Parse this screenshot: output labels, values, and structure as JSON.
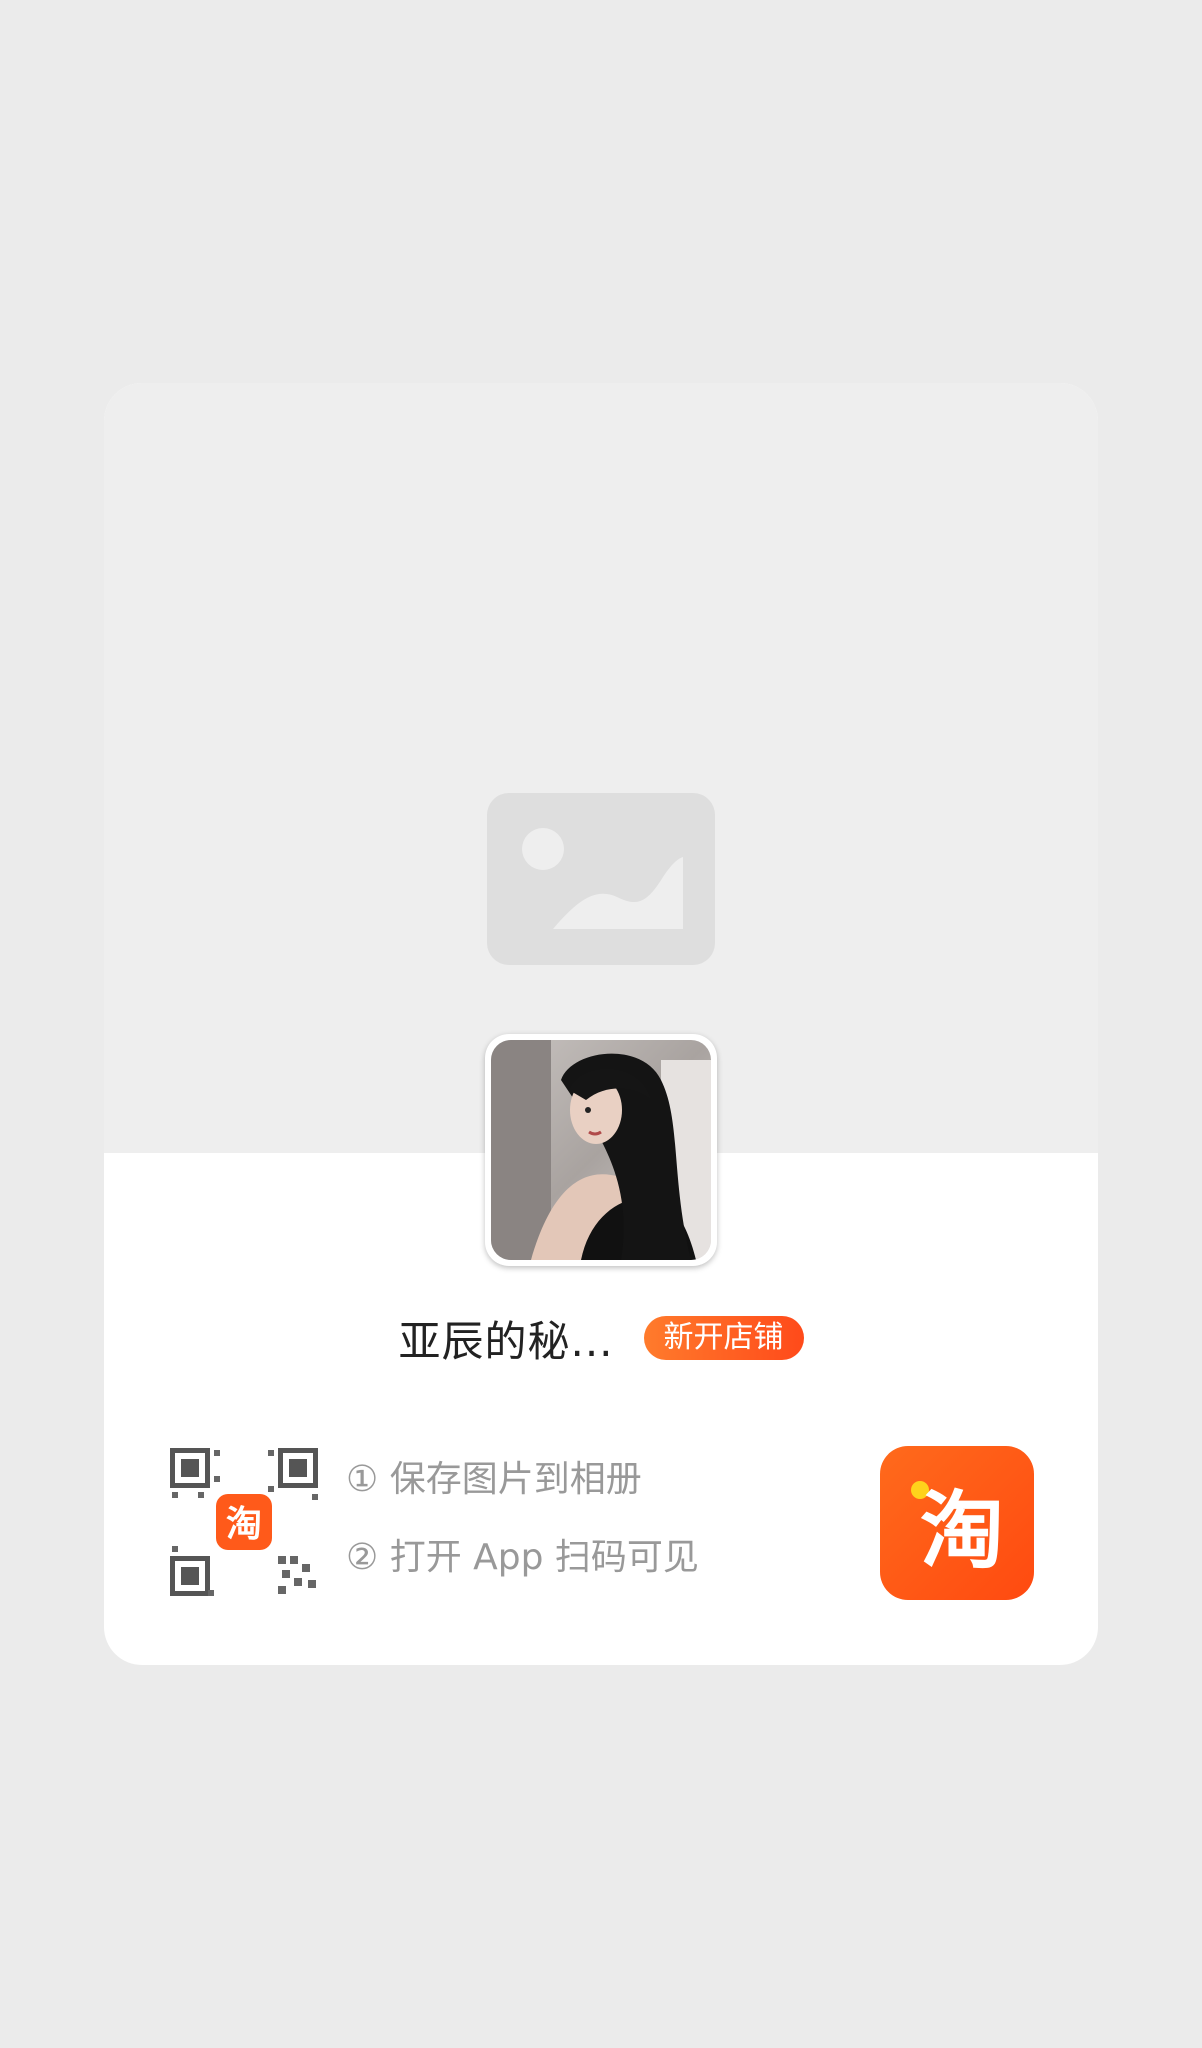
{
  "shop": {
    "name": "亚辰的秘...",
    "badge": "新开店铺"
  },
  "instructions": {
    "step1": "① 保存图片到相册",
    "step2": "② 打开 App 扫码可见"
  },
  "logo": {
    "text": "淘"
  },
  "icons": {
    "placeholder": "image-placeholder-icon",
    "qr": "qr-code-icon",
    "logo": "taobao-logo-icon"
  },
  "colors": {
    "page_bg": "#ebebeb",
    "card_top": "#eeeeee",
    "accent": "#ff5a1a",
    "text_dark": "#222222",
    "text_muted": "#999999"
  }
}
